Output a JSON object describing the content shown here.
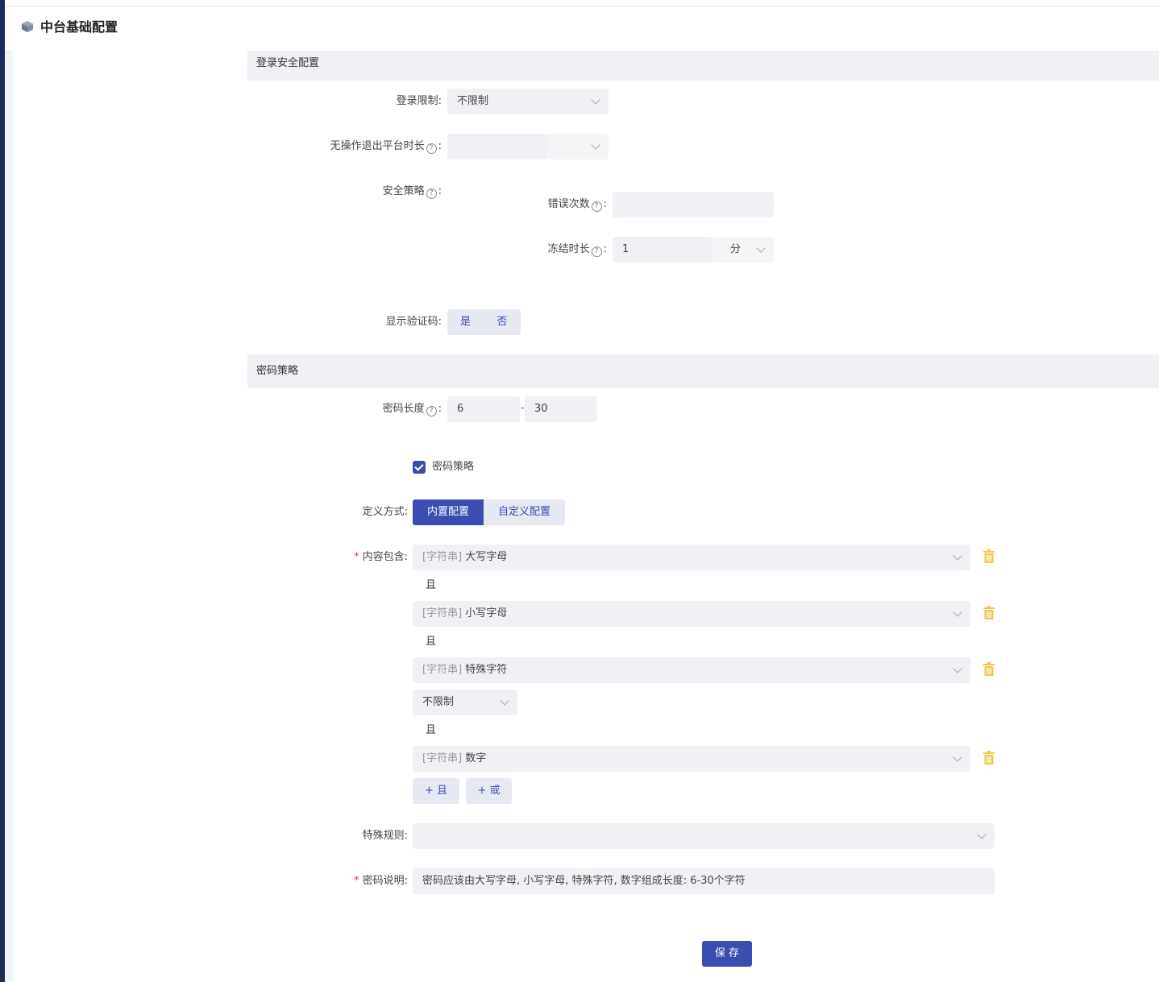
{
  "header": {
    "title": "中台基础配置",
    "icon": "cube-icon"
  },
  "login_section": {
    "title": "登录安全配置",
    "login_limit": {
      "label": "登录限制:",
      "value": "不限制"
    },
    "idle_timeout": {
      "label": "无操作退出平台时长",
      "colon": ":",
      "value": ""
    },
    "security_policy": {
      "label": "安全策略",
      "colon": ":"
    },
    "error_count": {
      "label": "错误次数",
      "colon": ":",
      "value": ""
    },
    "freeze_duration": {
      "label": "冻结时长",
      "colon": ":",
      "value": "1",
      "unit": "分"
    },
    "show_captcha": {
      "label": "显示验证码:",
      "options": [
        "是",
        "否"
      ],
      "selected": "是"
    }
  },
  "password_section": {
    "title": "密码策略",
    "length": {
      "label": "密码长度",
      "colon": ":",
      "min": "6",
      "separator": "-",
      "max": "30"
    },
    "policy_checkbox": {
      "label": "密码策略",
      "checked": true
    },
    "define_mode": {
      "label": "定义方式:",
      "options": [
        "内置配置",
        "自定义配置"
      ],
      "selected": "内置配置"
    },
    "content": {
      "label": "内容包含:",
      "required_mark": "*",
      "rules": [
        {
          "prefix": "[字符串]",
          "value": "大写字母"
        },
        {
          "prefix": "[字符串]",
          "value": "小写字母"
        },
        {
          "prefix": "[字符串]",
          "value": "特殊字符"
        },
        {
          "prefix": "[字符串]",
          "value": "数字"
        }
      ],
      "connector": "且",
      "limit_select": "不限制",
      "add_and": "+ 且",
      "add_or": "+ 或"
    },
    "special_rule": {
      "label": "特殊规则:",
      "value": ""
    },
    "description": {
      "label": "密码说明:",
      "required_mark": "*",
      "value": "密码应该由大写字母, 小写字母, 特殊字符, 数字组成长度: 6-30个字符"
    }
  },
  "save_label": "保 存",
  "colors": {
    "primary": "#3b4db0",
    "section_bg": "#f0f1f4",
    "trash": "#f0c74a",
    "sidebar": "#1e2a5a"
  }
}
